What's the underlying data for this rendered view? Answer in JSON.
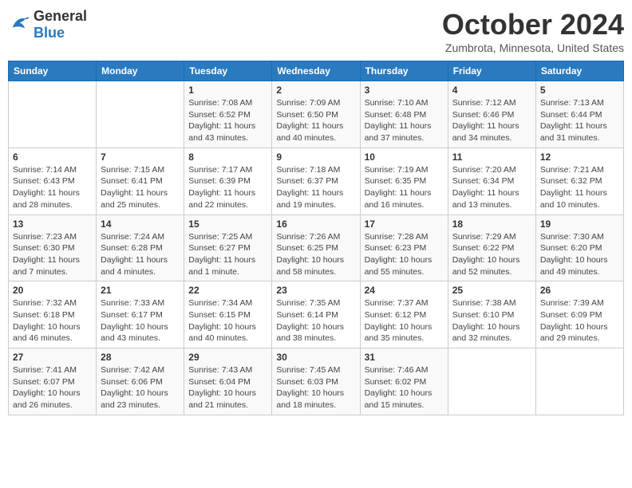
{
  "header": {
    "logo_general": "General",
    "logo_blue": "Blue",
    "month": "October 2024",
    "location": "Zumbrota, Minnesota, United States"
  },
  "days_of_week": [
    "Sunday",
    "Monday",
    "Tuesday",
    "Wednesday",
    "Thursday",
    "Friday",
    "Saturday"
  ],
  "weeks": [
    [
      {
        "day": "",
        "sunrise": "",
        "sunset": "",
        "daylight": ""
      },
      {
        "day": "",
        "sunrise": "",
        "sunset": "",
        "daylight": ""
      },
      {
        "day": "1",
        "sunrise": "Sunrise: 7:08 AM",
        "sunset": "Sunset: 6:52 PM",
        "daylight": "Daylight: 11 hours and 43 minutes."
      },
      {
        "day": "2",
        "sunrise": "Sunrise: 7:09 AM",
        "sunset": "Sunset: 6:50 PM",
        "daylight": "Daylight: 11 hours and 40 minutes."
      },
      {
        "day": "3",
        "sunrise": "Sunrise: 7:10 AM",
        "sunset": "Sunset: 6:48 PM",
        "daylight": "Daylight: 11 hours and 37 minutes."
      },
      {
        "day": "4",
        "sunrise": "Sunrise: 7:12 AM",
        "sunset": "Sunset: 6:46 PM",
        "daylight": "Daylight: 11 hours and 34 minutes."
      },
      {
        "day": "5",
        "sunrise": "Sunrise: 7:13 AM",
        "sunset": "Sunset: 6:44 PM",
        "daylight": "Daylight: 11 hours and 31 minutes."
      }
    ],
    [
      {
        "day": "6",
        "sunrise": "Sunrise: 7:14 AM",
        "sunset": "Sunset: 6:43 PM",
        "daylight": "Daylight: 11 hours and 28 minutes."
      },
      {
        "day": "7",
        "sunrise": "Sunrise: 7:15 AM",
        "sunset": "Sunset: 6:41 PM",
        "daylight": "Daylight: 11 hours and 25 minutes."
      },
      {
        "day": "8",
        "sunrise": "Sunrise: 7:17 AM",
        "sunset": "Sunset: 6:39 PM",
        "daylight": "Daylight: 11 hours and 22 minutes."
      },
      {
        "day": "9",
        "sunrise": "Sunrise: 7:18 AM",
        "sunset": "Sunset: 6:37 PM",
        "daylight": "Daylight: 11 hours and 19 minutes."
      },
      {
        "day": "10",
        "sunrise": "Sunrise: 7:19 AM",
        "sunset": "Sunset: 6:35 PM",
        "daylight": "Daylight: 11 hours and 16 minutes."
      },
      {
        "day": "11",
        "sunrise": "Sunrise: 7:20 AM",
        "sunset": "Sunset: 6:34 PM",
        "daylight": "Daylight: 11 hours and 13 minutes."
      },
      {
        "day": "12",
        "sunrise": "Sunrise: 7:21 AM",
        "sunset": "Sunset: 6:32 PM",
        "daylight": "Daylight: 11 hours and 10 minutes."
      }
    ],
    [
      {
        "day": "13",
        "sunrise": "Sunrise: 7:23 AM",
        "sunset": "Sunset: 6:30 PM",
        "daylight": "Daylight: 11 hours and 7 minutes."
      },
      {
        "day": "14",
        "sunrise": "Sunrise: 7:24 AM",
        "sunset": "Sunset: 6:28 PM",
        "daylight": "Daylight: 11 hours and 4 minutes."
      },
      {
        "day": "15",
        "sunrise": "Sunrise: 7:25 AM",
        "sunset": "Sunset: 6:27 PM",
        "daylight": "Daylight: 11 hours and 1 minute."
      },
      {
        "day": "16",
        "sunrise": "Sunrise: 7:26 AM",
        "sunset": "Sunset: 6:25 PM",
        "daylight": "Daylight: 10 hours and 58 minutes."
      },
      {
        "day": "17",
        "sunrise": "Sunrise: 7:28 AM",
        "sunset": "Sunset: 6:23 PM",
        "daylight": "Daylight: 10 hours and 55 minutes."
      },
      {
        "day": "18",
        "sunrise": "Sunrise: 7:29 AM",
        "sunset": "Sunset: 6:22 PM",
        "daylight": "Daylight: 10 hours and 52 minutes."
      },
      {
        "day": "19",
        "sunrise": "Sunrise: 7:30 AM",
        "sunset": "Sunset: 6:20 PM",
        "daylight": "Daylight: 10 hours and 49 minutes."
      }
    ],
    [
      {
        "day": "20",
        "sunrise": "Sunrise: 7:32 AM",
        "sunset": "Sunset: 6:18 PM",
        "daylight": "Daylight: 10 hours and 46 minutes."
      },
      {
        "day": "21",
        "sunrise": "Sunrise: 7:33 AM",
        "sunset": "Sunset: 6:17 PM",
        "daylight": "Daylight: 10 hours and 43 minutes."
      },
      {
        "day": "22",
        "sunrise": "Sunrise: 7:34 AM",
        "sunset": "Sunset: 6:15 PM",
        "daylight": "Daylight: 10 hours and 40 minutes."
      },
      {
        "day": "23",
        "sunrise": "Sunrise: 7:35 AM",
        "sunset": "Sunset: 6:14 PM",
        "daylight": "Daylight: 10 hours and 38 minutes."
      },
      {
        "day": "24",
        "sunrise": "Sunrise: 7:37 AM",
        "sunset": "Sunset: 6:12 PM",
        "daylight": "Daylight: 10 hours and 35 minutes."
      },
      {
        "day": "25",
        "sunrise": "Sunrise: 7:38 AM",
        "sunset": "Sunset: 6:10 PM",
        "daylight": "Daylight: 10 hours and 32 minutes."
      },
      {
        "day": "26",
        "sunrise": "Sunrise: 7:39 AM",
        "sunset": "Sunset: 6:09 PM",
        "daylight": "Daylight: 10 hours and 29 minutes."
      }
    ],
    [
      {
        "day": "27",
        "sunrise": "Sunrise: 7:41 AM",
        "sunset": "Sunset: 6:07 PM",
        "daylight": "Daylight: 10 hours and 26 minutes."
      },
      {
        "day": "28",
        "sunrise": "Sunrise: 7:42 AM",
        "sunset": "Sunset: 6:06 PM",
        "daylight": "Daylight: 10 hours and 23 minutes."
      },
      {
        "day": "29",
        "sunrise": "Sunrise: 7:43 AM",
        "sunset": "Sunset: 6:04 PM",
        "daylight": "Daylight: 10 hours and 21 minutes."
      },
      {
        "day": "30",
        "sunrise": "Sunrise: 7:45 AM",
        "sunset": "Sunset: 6:03 PM",
        "daylight": "Daylight: 10 hours and 18 minutes."
      },
      {
        "day": "31",
        "sunrise": "Sunrise: 7:46 AM",
        "sunset": "Sunset: 6:02 PM",
        "daylight": "Daylight: 10 hours and 15 minutes."
      },
      {
        "day": "",
        "sunrise": "",
        "sunset": "",
        "daylight": ""
      },
      {
        "day": "",
        "sunrise": "",
        "sunset": "",
        "daylight": ""
      }
    ]
  ]
}
